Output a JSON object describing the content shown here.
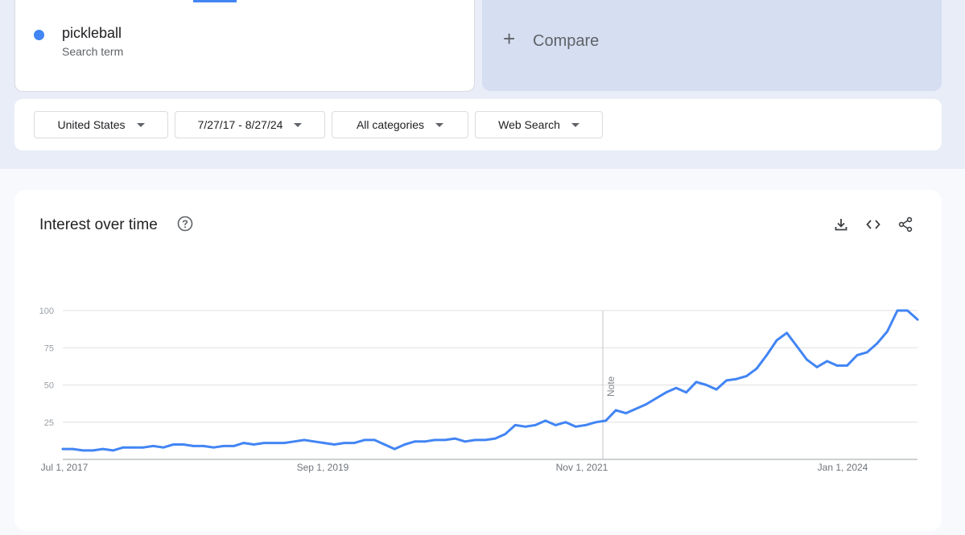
{
  "search_term": {
    "name": "pickleball",
    "type": "Search term",
    "color": "#4285f4"
  },
  "compare": {
    "label": "Compare"
  },
  "filters": {
    "region": "United States",
    "date_range": "7/27/17 - 8/27/24",
    "category": "All categories",
    "property": "Web Search"
  },
  "chart_title": "Interest over time",
  "icons": {
    "help": "help-circle-icon",
    "download": "download-icon",
    "embed": "embed-code-icon",
    "share": "share-icon"
  },
  "chart_data": {
    "type": "line",
    "title": "Interest over time",
    "series": [
      {
        "name": "pickleball",
        "color": "#4285f4",
        "values": [
          7,
          7,
          6,
          6,
          7,
          6,
          8,
          8,
          8,
          9,
          8,
          10,
          10,
          9,
          9,
          8,
          9,
          9,
          11,
          10,
          11,
          11,
          11,
          12,
          13,
          12,
          11,
          10,
          11,
          11,
          13,
          13,
          10,
          7,
          10,
          12,
          12,
          13,
          13,
          14,
          12,
          13,
          13,
          14,
          17,
          23,
          22,
          23,
          26,
          23,
          25,
          22,
          23,
          25,
          26,
          33,
          31,
          34,
          37,
          41,
          45,
          48,
          45,
          52,
          50,
          47,
          53,
          54,
          56,
          61,
          70,
          80,
          85,
          76,
          67,
          62,
          66,
          63,
          63,
          70,
          72,
          78,
          86,
          100,
          100,
          94
        ]
      }
    ],
    "x_ticks": [
      "Jul 1, 2017",
      "Sep 1, 2019",
      "Nov 1, 2021",
      "Jan 1, 2024"
    ],
    "y_ticks": [
      25,
      50,
      75,
      100
    ],
    "ylim": [
      0,
      100
    ],
    "annotations": [
      "Note"
    ],
    "grid": true
  }
}
